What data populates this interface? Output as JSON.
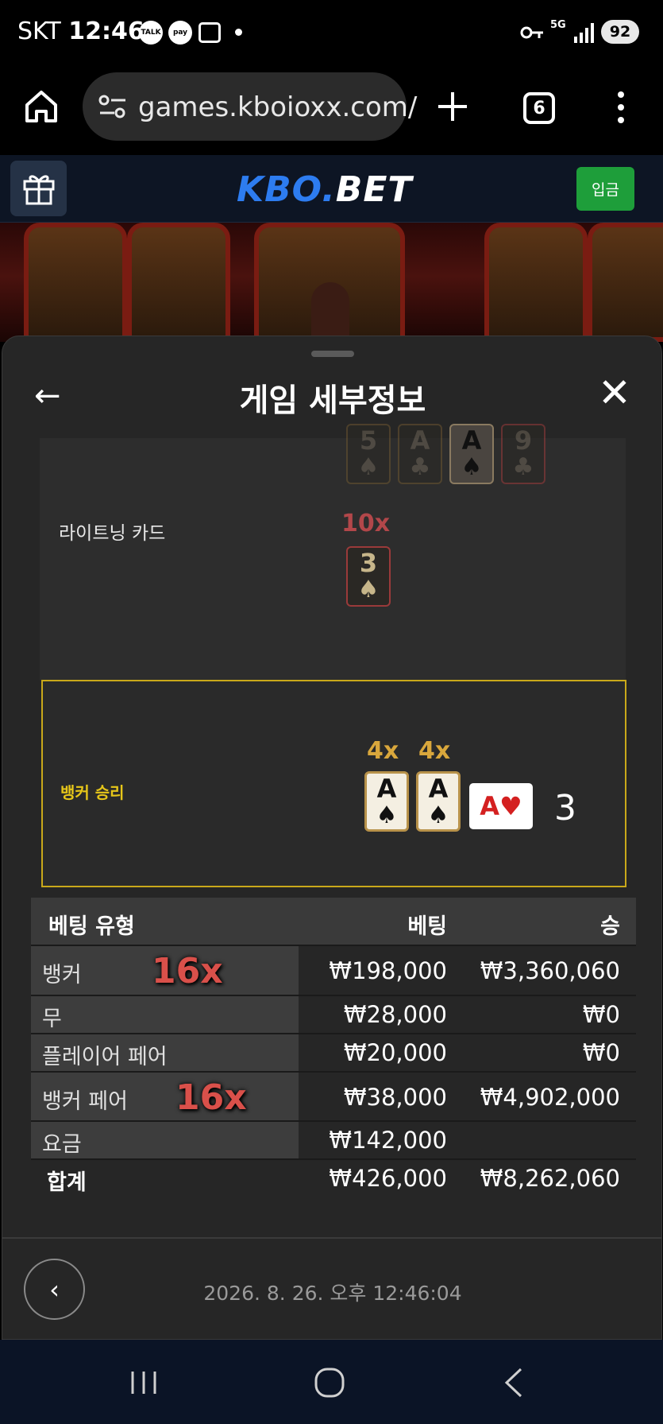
{
  "status_bar": {
    "carrier": "SKT",
    "time": "12:46",
    "icons": [
      "talk-icon",
      "pay-icon",
      "screenshot-icon",
      "dot-icon",
      "key-icon",
      "5g-icon",
      "signal-icon"
    ],
    "talk_label": "TALK",
    "pay_label": "pay",
    "battery": "92"
  },
  "browser": {
    "url": "games.kboioxx.com/",
    "tab_count": "6"
  },
  "site": {
    "logo_part1": "KBO.",
    "logo_part2": "BET",
    "deposit_label": "입금"
  },
  "modal": {
    "title": "게임 세부정보",
    "lightning_label": "라이트닝 카드",
    "top_cards": [
      {
        "rank": "5",
        "suit": "♠"
      },
      {
        "rank": "A",
        "suit": "♣"
      },
      {
        "rank": "A",
        "suit": "♠"
      },
      {
        "rank": "9",
        "suit": "♣"
      }
    ],
    "lightning_mult": "10x",
    "lightning_card": {
      "rank": "3",
      "suit": "♠"
    },
    "banker_label": "뱅커 승리",
    "banker_mults": [
      "4x",
      "4x"
    ],
    "banker_cards": [
      {
        "rank": "A",
        "suit": "♠"
      },
      {
        "rank": "A",
        "suit": "♠"
      }
    ],
    "side_card": "A♥",
    "banker_score": "3"
  },
  "table": {
    "headers": {
      "type": "베팅 유형",
      "bet": "베팅",
      "win": "승"
    },
    "rows": [
      {
        "name": "뱅커",
        "mult": "16x",
        "bet": "₩198,000",
        "win": "₩3,360,060"
      },
      {
        "name": "무",
        "mult": "",
        "bet": "₩28,000",
        "win": "₩0"
      },
      {
        "name": "플레이어 페어",
        "mult": "",
        "bet": "₩20,000",
        "win": "₩0"
      },
      {
        "name": "뱅커 페어",
        "mult": "16x",
        "bet": "₩38,000",
        "win": "₩4,902,000"
      },
      {
        "name": "요금",
        "mult": "",
        "bet": "₩142,000",
        "win": ""
      }
    ],
    "total": {
      "name": "합계",
      "bet": "₩426,000",
      "win": "₩8,262,060"
    }
  },
  "footer": {
    "timestamp": "2026. 8. 26. 오후 12:46:04"
  },
  "colors": {
    "accent_blue": "#2d7cf0",
    "deposit_green": "#1e9e3a",
    "banker_gold": "#e6c619",
    "multiplier_red": "#d9504a"
  }
}
